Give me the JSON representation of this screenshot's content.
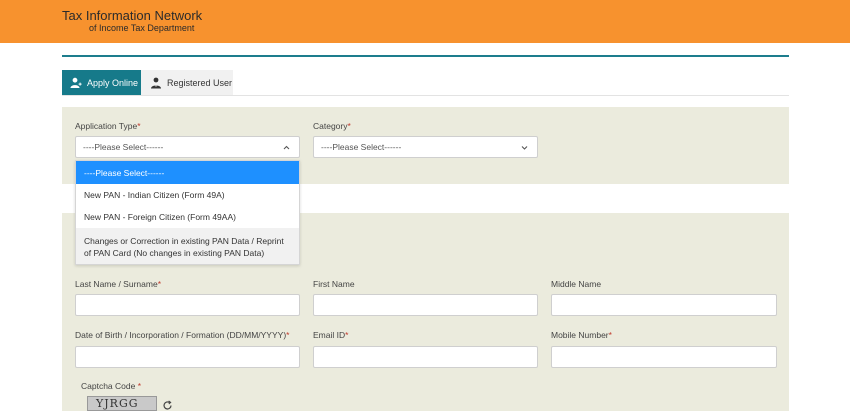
{
  "header": {
    "title": "Tax Information Network",
    "subtitle": "of Income Tax Department",
    "background_color": "#f7922e"
  },
  "tabs": [
    {
      "label": "Apply Online",
      "icon": "user-plus-icon",
      "active": true
    },
    {
      "label": "Registered User",
      "icon": "user-tie-icon",
      "active": false
    }
  ],
  "form": {
    "application_type": {
      "label": "Application Type",
      "required": "*",
      "value": "----Please Select------"
    },
    "category": {
      "label": "Category",
      "required": "*",
      "value": "----Please Select------"
    },
    "dropdown_options": [
      "----Please Select------",
      "New PAN - Indian Citizen (Form 49A)",
      "New PAN - Foreign Citizen (Form 49AA)",
      "Changes or Correction in existing PAN Data / Reprint of PAN Card (No changes in existing PAN Data)"
    ],
    "last_name": {
      "label": "Last Name / Surname",
      "required": "*"
    },
    "first_name": {
      "label": "First Name"
    },
    "middle_name": {
      "label": "Middle Name"
    },
    "dob": {
      "label": "Date of Birth / Incorporation / Formation (DD/MM/YYYY)",
      "required": "*"
    },
    "email": {
      "label": "Email ID",
      "required": "*"
    },
    "mobile": {
      "label": "Mobile Number",
      "required": "*"
    },
    "captcha": {
      "label": "Captcha Code",
      "required": " *",
      "image_text": "YJRGG"
    }
  },
  "colors": {
    "accent": "#167a8a",
    "panel": "#ebebdd",
    "selected_option": "#1e90ff"
  }
}
